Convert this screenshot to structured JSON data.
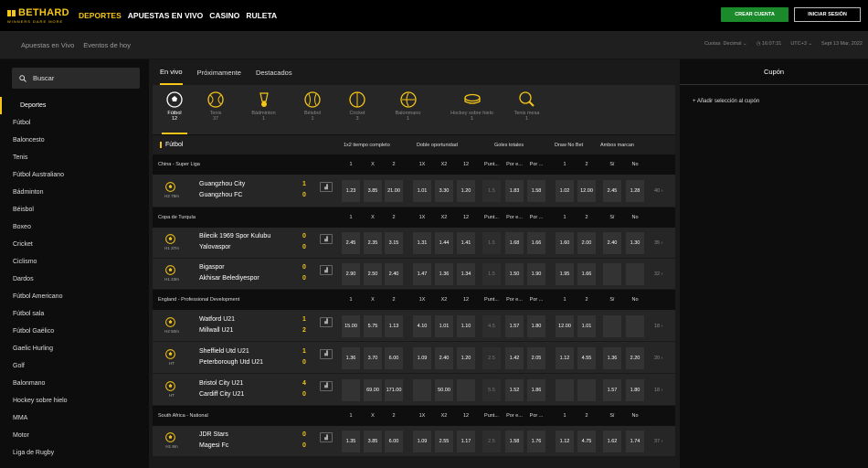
{
  "brand": {
    "name": "BETHARD",
    "tagline": "WINNERS DARE MORE",
    "accent": "#f5c518",
    "green": "#1b8a2a"
  },
  "topnav": {
    "items": [
      "DEPORTES",
      "APUESTAS EN VIVO",
      "CASINO",
      "RULETA"
    ],
    "create_label": "CREAR CUENTA",
    "login_label": "INICIAR SESIÓN"
  },
  "subnav": {
    "items": [
      "Apuestas en Vivo",
      "Eventos de hoy"
    ],
    "odds_label": "Cuotas",
    "odds_format": "Decimal",
    "time": "16:07:31",
    "timezone": "UTC+3",
    "date": "Sept 13 Mar, 2022"
  },
  "sidebar": {
    "search_placeholder": "Buscar",
    "items": [
      "Deportes",
      "Fútbol",
      "Baloncesto",
      "Tenis",
      "Fútbol Australiano",
      "Bádminton",
      "Béisbol",
      "Boxeo",
      "Cricket",
      "Ciclismo",
      "Dardos",
      "Fútbol Americano",
      "Fútbol sala",
      "Fútbol Gaélico",
      "Gaelic Hurling",
      "Golf",
      "Balonmano",
      "Hockey sobre hielo",
      "MMA",
      "Motor",
      "Liga de Rugby"
    ]
  },
  "main": {
    "tabs": [
      "En vivo",
      "Próximamente",
      "Destacados"
    ],
    "sports": [
      {
        "name": "Fútbol",
        "count": "12",
        "icon": "soccer-ball-icon"
      },
      {
        "name": "Tenis",
        "count": "37",
        "icon": "tennis-ball-icon"
      },
      {
        "name": "Bádminton",
        "count": "1",
        "icon": "shuttlecock-icon"
      },
      {
        "name": "Béisbol",
        "count": "1",
        "icon": "baseball-icon"
      },
      {
        "name": "Cricket",
        "count": "3",
        "icon": "cricket-ball-icon"
      },
      {
        "name": "Balonmano",
        "count": "1",
        "icon": "handball-icon"
      },
      {
        "name": "Hockey sobre hielo",
        "count": "1",
        "icon": "hockey-puck-icon"
      },
      {
        "name": "Tenis mesa",
        "count": "1",
        "icon": "table-tennis-icon"
      }
    ],
    "section_title": "Fútbol",
    "markets": [
      "1x2 tiempo completo",
      "Doble oportunidad",
      "Goles totales",
      "Draw No Bet",
      "Ambos marcan"
    ],
    "columns": [
      "1",
      "X",
      "2",
      "1X",
      "X2",
      "12",
      "Punt...",
      "Por e...",
      "Por ...",
      "1",
      "2",
      "Sí",
      "No"
    ],
    "leagues": [
      {
        "name": "China - Super Liga",
        "matches": [
          {
            "time": "H2 78m",
            "home": "Guangzhou City",
            "away": "Guangzhou FC",
            "home_score": "1",
            "away_score": "0",
            "odds": [
              "1.23",
              "3.85",
              "21.00",
              "1.01",
              "3.30",
              "1.20",
              "1.5",
              "1.83",
              "1.58",
              "1.02",
              "12.00",
              "2.45",
              "1.28"
            ],
            "more": "40"
          }
        ]
      },
      {
        "name": "Copa de Turquía",
        "matches": [
          {
            "time": "H1 37m",
            "home": "Bilecik 1969 Spor Kulubu",
            "away": "Yalovaspor",
            "home_score": "0",
            "away_score": "0",
            "odds": [
              "2.45",
              "2.35",
              "3.15",
              "1.31",
              "1.44",
              "1.41",
              "1.5",
              "1.68",
              "1.66",
              "1.60",
              "2.00",
              "2.40",
              "1.30"
            ],
            "more": "35"
          },
          {
            "time": "H1 23m",
            "home": "Bigaspor",
            "away": "Akhisar Belediyespor",
            "home_score": "0",
            "away_score": "0",
            "odds": [
              "2.90",
              "2.50",
              "2.40",
              "1.47",
              "1.36",
              "1.34",
              "1.5",
              "1.50",
              "1.90",
              "1.95",
              "1.66",
              "",
              ""
            ],
            "more": "32"
          }
        ]
      },
      {
        "name": "England - Professional Development",
        "matches": [
          {
            "time": "H2 50m",
            "home": "Watford U21",
            "away": "Millwall U21",
            "home_score": "1",
            "away_score": "2",
            "odds": [
              "15.00",
              "5.75",
              "1.13",
              "4.10",
              "1.01",
              "1.10",
              "4.5",
              "1.57",
              "1.80",
              "12.00",
              "1.01",
              "",
              ""
            ],
            "more": "18"
          },
          {
            "time": "HT",
            "home": "Sheffield Utd U21",
            "away": "Peterborough Utd U21",
            "home_score": "1",
            "away_score": "0",
            "odds": [
              "1.36",
              "3.70",
              "6.00",
              "1.09",
              "2.40",
              "1.20",
              "2.5",
              "1.42",
              "2.05",
              "1.12",
              "4.55",
              "1.36",
              "2.20"
            ],
            "more": "20"
          },
          {
            "time": "HT",
            "home": "Bristol City U21",
            "away": "Cardiff City U21",
            "home_score": "4",
            "away_score": "0",
            "odds": [
              "",
              "69.00",
              "171.00",
              "",
              "50.00",
              "",
              "5.5",
              "1.52",
              "1.86",
              "",
              "",
              "1.57",
              "1.80"
            ],
            "more": "18"
          }
        ]
      },
      {
        "name": "South Africa - National",
        "matches": [
          {
            "time": "H1 8m",
            "home": "JDR Stars",
            "away": "Magesi Fc",
            "home_score": "0",
            "away_score": "0",
            "odds": [
              "1.35",
              "3.85",
              "6.00",
              "1.09",
              "2.55",
              "1.17",
              "2.5",
              "1.58",
              "1.76",
              "1.12",
              "4.75",
              "1.62",
              "1.74"
            ],
            "more": "37"
          }
        ]
      }
    ]
  },
  "coupon": {
    "title": "Cupón",
    "add_label": "+ Añadir selección al cupón"
  }
}
